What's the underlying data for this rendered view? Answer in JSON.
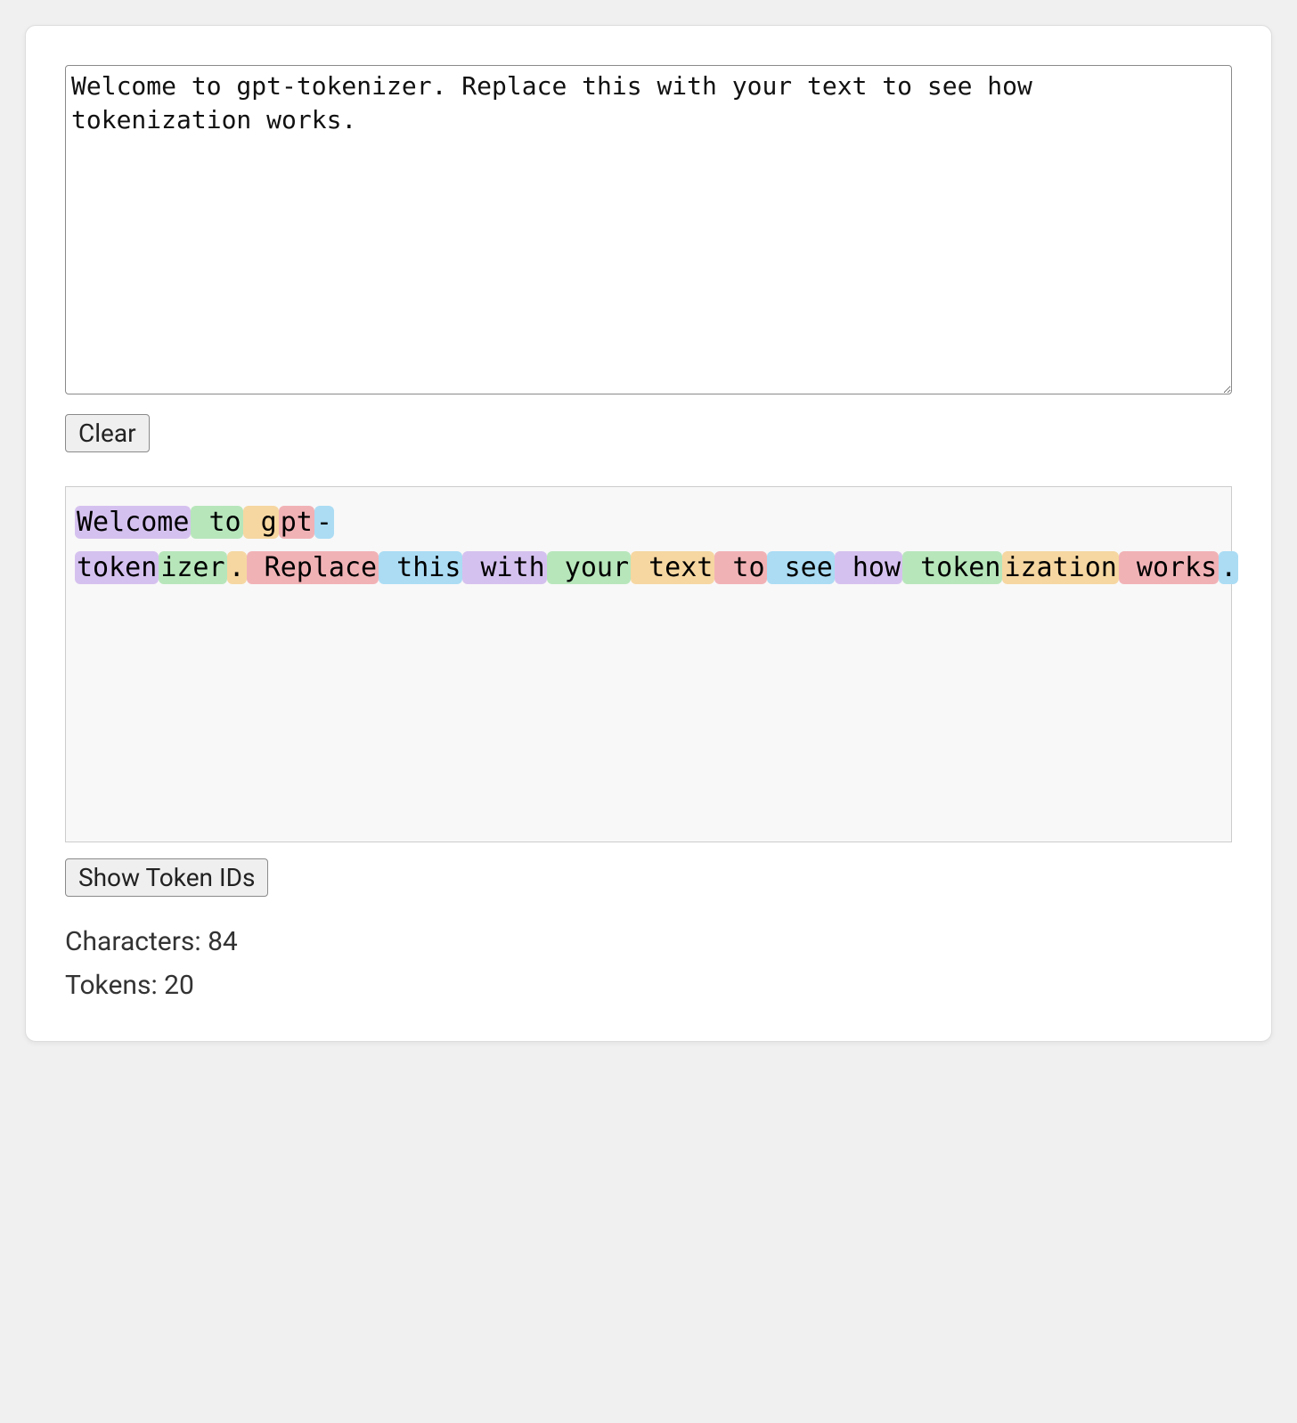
{
  "input": {
    "value": "Welcome to gpt-tokenizer. Replace this with your text to see how tokenization works."
  },
  "buttons": {
    "clear_label": "Clear",
    "show_ids_label": "Show Token IDs"
  },
  "tokens": [
    {
      "text": "Welcome",
      "color": 0
    },
    {
      "text": " to",
      "color": 1
    },
    {
      "text": " g",
      "color": 2
    },
    {
      "text": "pt",
      "color": 3
    },
    {
      "text": "-",
      "color": 4
    },
    {
      "text": "token",
      "color": 0
    },
    {
      "text": "izer",
      "color": 1
    },
    {
      "text": ".",
      "color": 2
    },
    {
      "text": " Replace",
      "color": 3
    },
    {
      "text": " this",
      "color": 4
    },
    {
      "text": " with",
      "color": 0
    },
    {
      "text": " your",
      "color": 1
    },
    {
      "text": " text",
      "color": 2
    },
    {
      "text": " to",
      "color": 3
    },
    {
      "text": " see",
      "color": 4
    },
    {
      "text": " how",
      "color": 0
    },
    {
      "text": " token",
      "color": 1
    },
    {
      "text": "ization",
      "color": 2
    },
    {
      "text": " works",
      "color": 3
    },
    {
      "text": ".",
      "color": 4
    }
  ],
  "stats": {
    "characters_label": "Characters",
    "characters_value": "84",
    "tokens_label": "Tokens",
    "tokens_value": "20"
  }
}
